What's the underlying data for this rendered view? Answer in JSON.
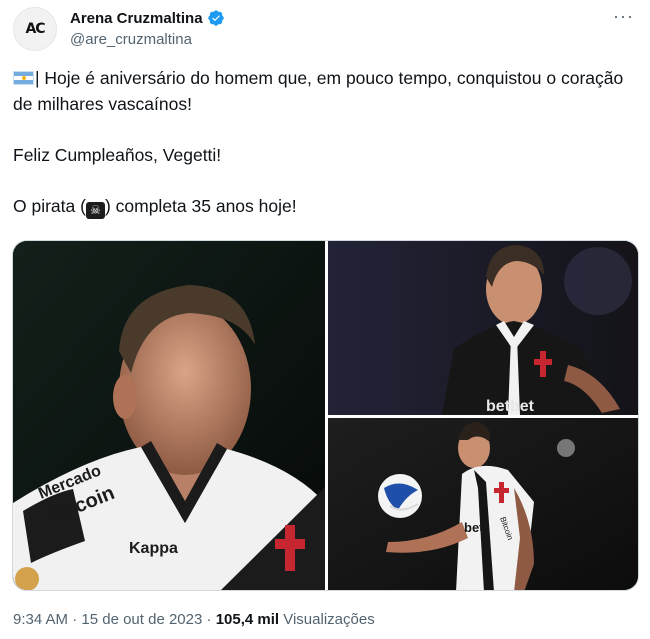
{
  "author": {
    "avatar_text": "AC",
    "display_name": "Arena Cruzmaltina",
    "handle": "@are_cruzmaltina",
    "verified": true
  },
  "more_label": "···",
  "tweet": {
    "line1": "| Hoje é aniversário do homem que, em pouco tempo, conquistou o coração de milhares vascaínos!",
    "line2": "Feliz Cumpleaños, Vegetti!",
    "line3_prefix": "O pirata (",
    "line3_suffix": ") completa 35 anos hoje!"
  },
  "photos": [
    {
      "jersey_text_1": "Mercado",
      "jersey_text_2": "Bitcoin",
      "brand": "Kappa"
    },
    {
      "jersey_sponsor": "betbet"
    },
    {
      "jersey_sponsor": "bet",
      "jersey_side": "Bitcoin"
    }
  ],
  "meta": {
    "time": "9:34 AM",
    "separator": " · ",
    "date": "15 de out de 2023",
    "views_count": "105,4 mil",
    "views_label": " Visualizações"
  },
  "colors": {
    "text": "#0f1419",
    "muted": "#536471",
    "verified": "#1d9bf0",
    "border": "#cfd9de"
  }
}
